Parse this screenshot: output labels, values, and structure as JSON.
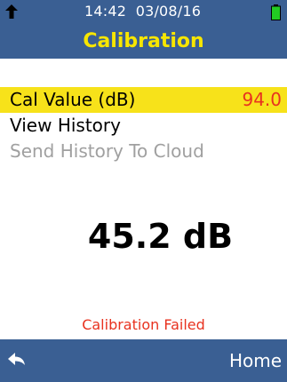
{
  "colors": {
    "header_bg": "#3a5f93",
    "title": "#f7e600",
    "selected_bg": "#f7e21a",
    "alert": "#e8321f",
    "disabled_text": "#a0a0a0",
    "battery": "#22cc22"
  },
  "status_bar": {
    "time": "14:42",
    "date": "03/08/16",
    "left_icon": "up-arrow-icon",
    "right_icon": "battery-icon"
  },
  "header": {
    "title": "Calibration"
  },
  "menu": {
    "items": [
      {
        "label": "Cal Value (dB)",
        "value": "94.0",
        "selected": true,
        "enabled": true
      },
      {
        "label": "View History",
        "value": "",
        "selected": false,
        "enabled": true
      },
      {
        "label": "Send History To Cloud",
        "value": "",
        "selected": false,
        "enabled": false
      }
    ]
  },
  "reading": {
    "value": "45.2 dB"
  },
  "status_message": "Calibration Failed",
  "footer": {
    "back_icon": "back-arrow-icon",
    "home_label": "Home"
  }
}
